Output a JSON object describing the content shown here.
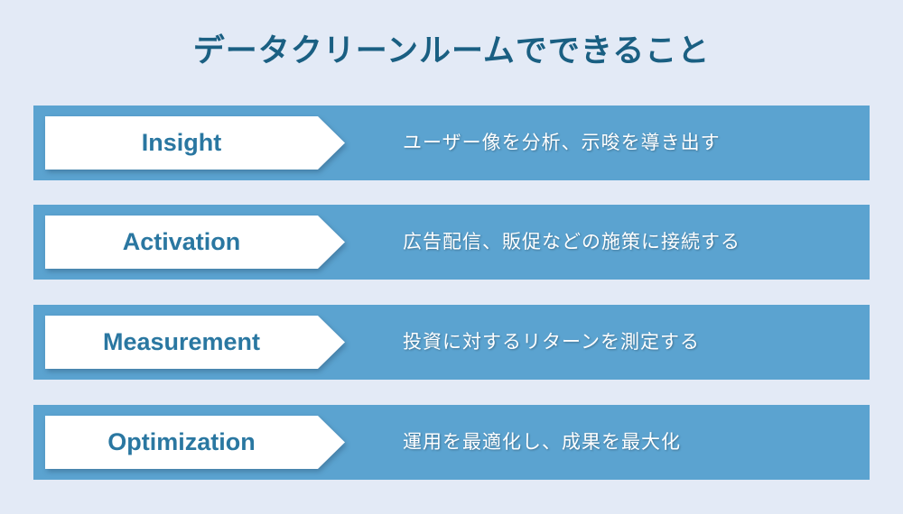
{
  "title": "データクリーンルームでできること",
  "colors": {
    "background": "#e3eaf6",
    "title": "#1a5f82",
    "row_bg": "#5ba3d0",
    "label": "#2a77a1",
    "arrow_fill": "#ffffff",
    "description": "#ffffff"
  },
  "rows": [
    {
      "label": "Insight",
      "description": "ユーザー像を分析、示唆を導き出す"
    },
    {
      "label": "Activation",
      "description": "広告配信、販促などの施策に接続する"
    },
    {
      "label": "Measurement",
      "description": "投資に対するリターンを測定する"
    },
    {
      "label": "Optimization",
      "description": "運用を最適化し、成果を最大化"
    }
  ]
}
